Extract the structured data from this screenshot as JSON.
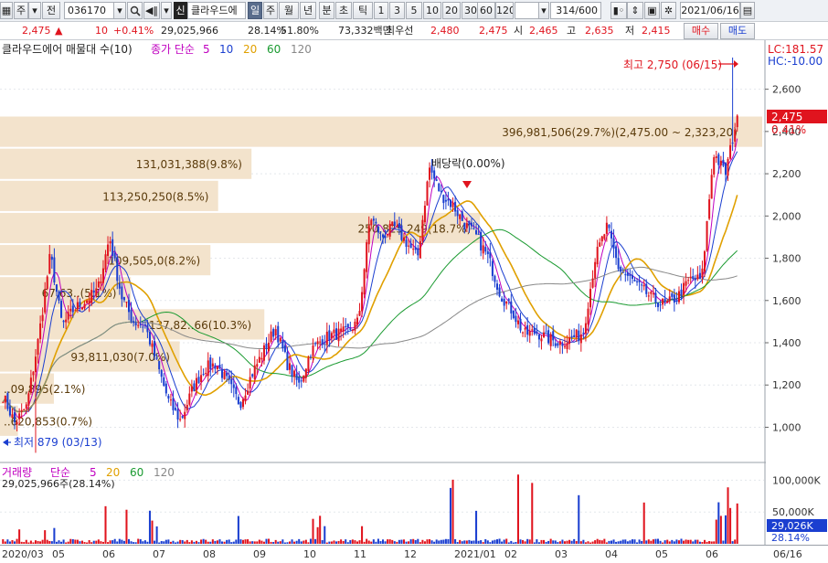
{
  "toolbar": {
    "market_tab": "주",
    "prev_label": "전",
    "code": "036170",
    "name": "클라우드에",
    "sin_badge": "신",
    "periods": [
      "일",
      "주",
      "월",
      "년",
      "분",
      "초",
      "틱"
    ],
    "active_period": "일",
    "intervals": [
      "1",
      "3",
      "5",
      "10",
      "20",
      "30",
      "60",
      "120"
    ],
    "counter": "314/600",
    "date": "2021/06/16"
  },
  "pricebar": {
    "price": "2,475",
    "change": "10",
    "change_pct": "+0.41%",
    "volume": "29,025,966",
    "vol_ratio": "28.14%",
    "turnover": "51.80%",
    "amount": "73,332백만",
    "best_ask_label": "최우선",
    "best_ask": "2,480",
    "best_bid": "2,475",
    "open_label": "시",
    "open": "2,465",
    "high_label": "고",
    "high": "2,635",
    "low_label": "저",
    "low": "2,415",
    "buy_label": "매수",
    "sell_label": "매도"
  },
  "price_panel": {
    "title": "클라우드에어 매물대 수(10)",
    "legend_prefix": "종가 단순",
    "ma_periods": [
      "5",
      "10",
      "20",
      "60",
      "120"
    ],
    "ma_colors": [
      "#c000c0",
      "#1b3fd0",
      "#e0a000",
      "#1a9a30",
      "#888888"
    ],
    "lc_label": "LC:181.57",
    "hc_label": "HC:-10.00",
    "last_price_tag": "2,475",
    "last_pct_tag": "0.41%",
    "annotation_high": "최고 2,750 (06/15)",
    "annotation_low": "최저 879 (03/13)",
    "annotation_dividend": "배당락(0.00%)",
    "y_ticks": [
      "2,600",
      "2,400",
      "2,200",
      "2,000",
      "1,800",
      "1,600",
      "1,400",
      "1,200",
      "1,000"
    ],
    "y_tick_values": [
      2600,
      2400,
      2200,
      2000,
      1800,
      1600,
      1400,
      1200,
      1000
    ],
    "visible_y_range": [
      842,
      2832
    ],
    "volume_profile": [
      {
        "label": "396,981,506(29.7%)(2,475.00 ~ 2,323,20)",
        "pct": 29.7,
        "from": 2323,
        "to": 2475
      },
      {
        "label": "131,031,388(9.8%)",
        "pct": 9.8,
        "from": 2171,
        "to": 2323
      },
      {
        "label": "113,250,250(8.5%)",
        "pct": 8.5,
        "from": 2019,
        "to": 2171
      },
      {
        "label": "250,825,249(18.7%)",
        "pct": 18.7,
        "from": 1867,
        "to": 2019
      },
      {
        "label": "109,505,0(8.2%)",
        "pct": 8.2,
        "from": 1715,
        "to": 1867
      },
      {
        "label": "67,63..(5.1%)",
        "pct": 5.1,
        "from": 1563,
        "to": 1715
      },
      {
        "label": "137,82..66(10.3%)",
        "pct": 10.3,
        "from": 1411,
        "to": 1563
      },
      {
        "label": "93,811,030(7.0%)",
        "pct": 7.0,
        "from": 1259,
        "to": 1411
      },
      {
        "label": "..09,895(2.1%)",
        "pct": 2.1,
        "from": 1107,
        "to": 1259
      },
      {
        "label": "..620,853(0.7%)",
        "pct": 0.7,
        "from": 955,
        "to": 1107
      }
    ]
  },
  "volume_panel": {
    "title": "거래량",
    "legend_prefix": "단순",
    "ma_periods": [
      "5",
      "20",
      "60",
      "120"
    ],
    "info": "29,025,966주(28.14%)",
    "y_ticks": [
      "100,000K",
      "50,000K"
    ],
    "y_tick_values": [
      100000,
      50000
    ],
    "last_tag": "29,026K",
    "last_pct": "28.14%"
  },
  "x_axis": [
    "2020/03",
    "05",
    "06",
    "07",
    "08",
    "09",
    "10",
    "11",
    "12",
    "2021/01",
    "02",
    "03",
    "04",
    "05",
    "06",
    "06/16"
  ],
  "colors": {
    "up": "#e0141e",
    "down": "#1b3fd0",
    "profile": "#f3e3cc",
    "profile_text": "#5a3a0a"
  },
  "chart_data": {
    "type": "candlestick",
    "series_anchor_closes": [
      1150,
      1020,
      1100,
      1420,
      1820,
      1480,
      1560,
      1600,
      1650,
      1900,
      1620,
      1500,
      1480,
      1300,
      1120,
      1030,
      1180,
      1280,
      1300,
      1210,
      1110,
      1250,
      1360,
      1470,
      1300,
      1200,
      1360,
      1420,
      1440,
      1450,
      1500,
      2000,
      1900,
      1950,
      1880,
      1800,
      2230,
      2100,
      2050,
      1960,
      1900,
      1800,
      1630,
      1550,
      1440,
      1450,
      1420,
      1400,
      1420,
      1450,
      1800,
      1950,
      1750,
      1700,
      1650,
      1600,
      1580,
      1620,
      1700,
      1700,
      2300,
      2200,
      2475
    ],
    "low_point": {
      "value": 879,
      "date": "03/13"
    },
    "high_point": {
      "value": 2750,
      "date": "06/15"
    },
    "last_close": 2475,
    "volume_peaks": [
      25000,
      60000,
      45000,
      50000,
      110000,
      105000,
      92000
    ],
    "volume_ylim": [
      0,
      125000
    ]
  }
}
